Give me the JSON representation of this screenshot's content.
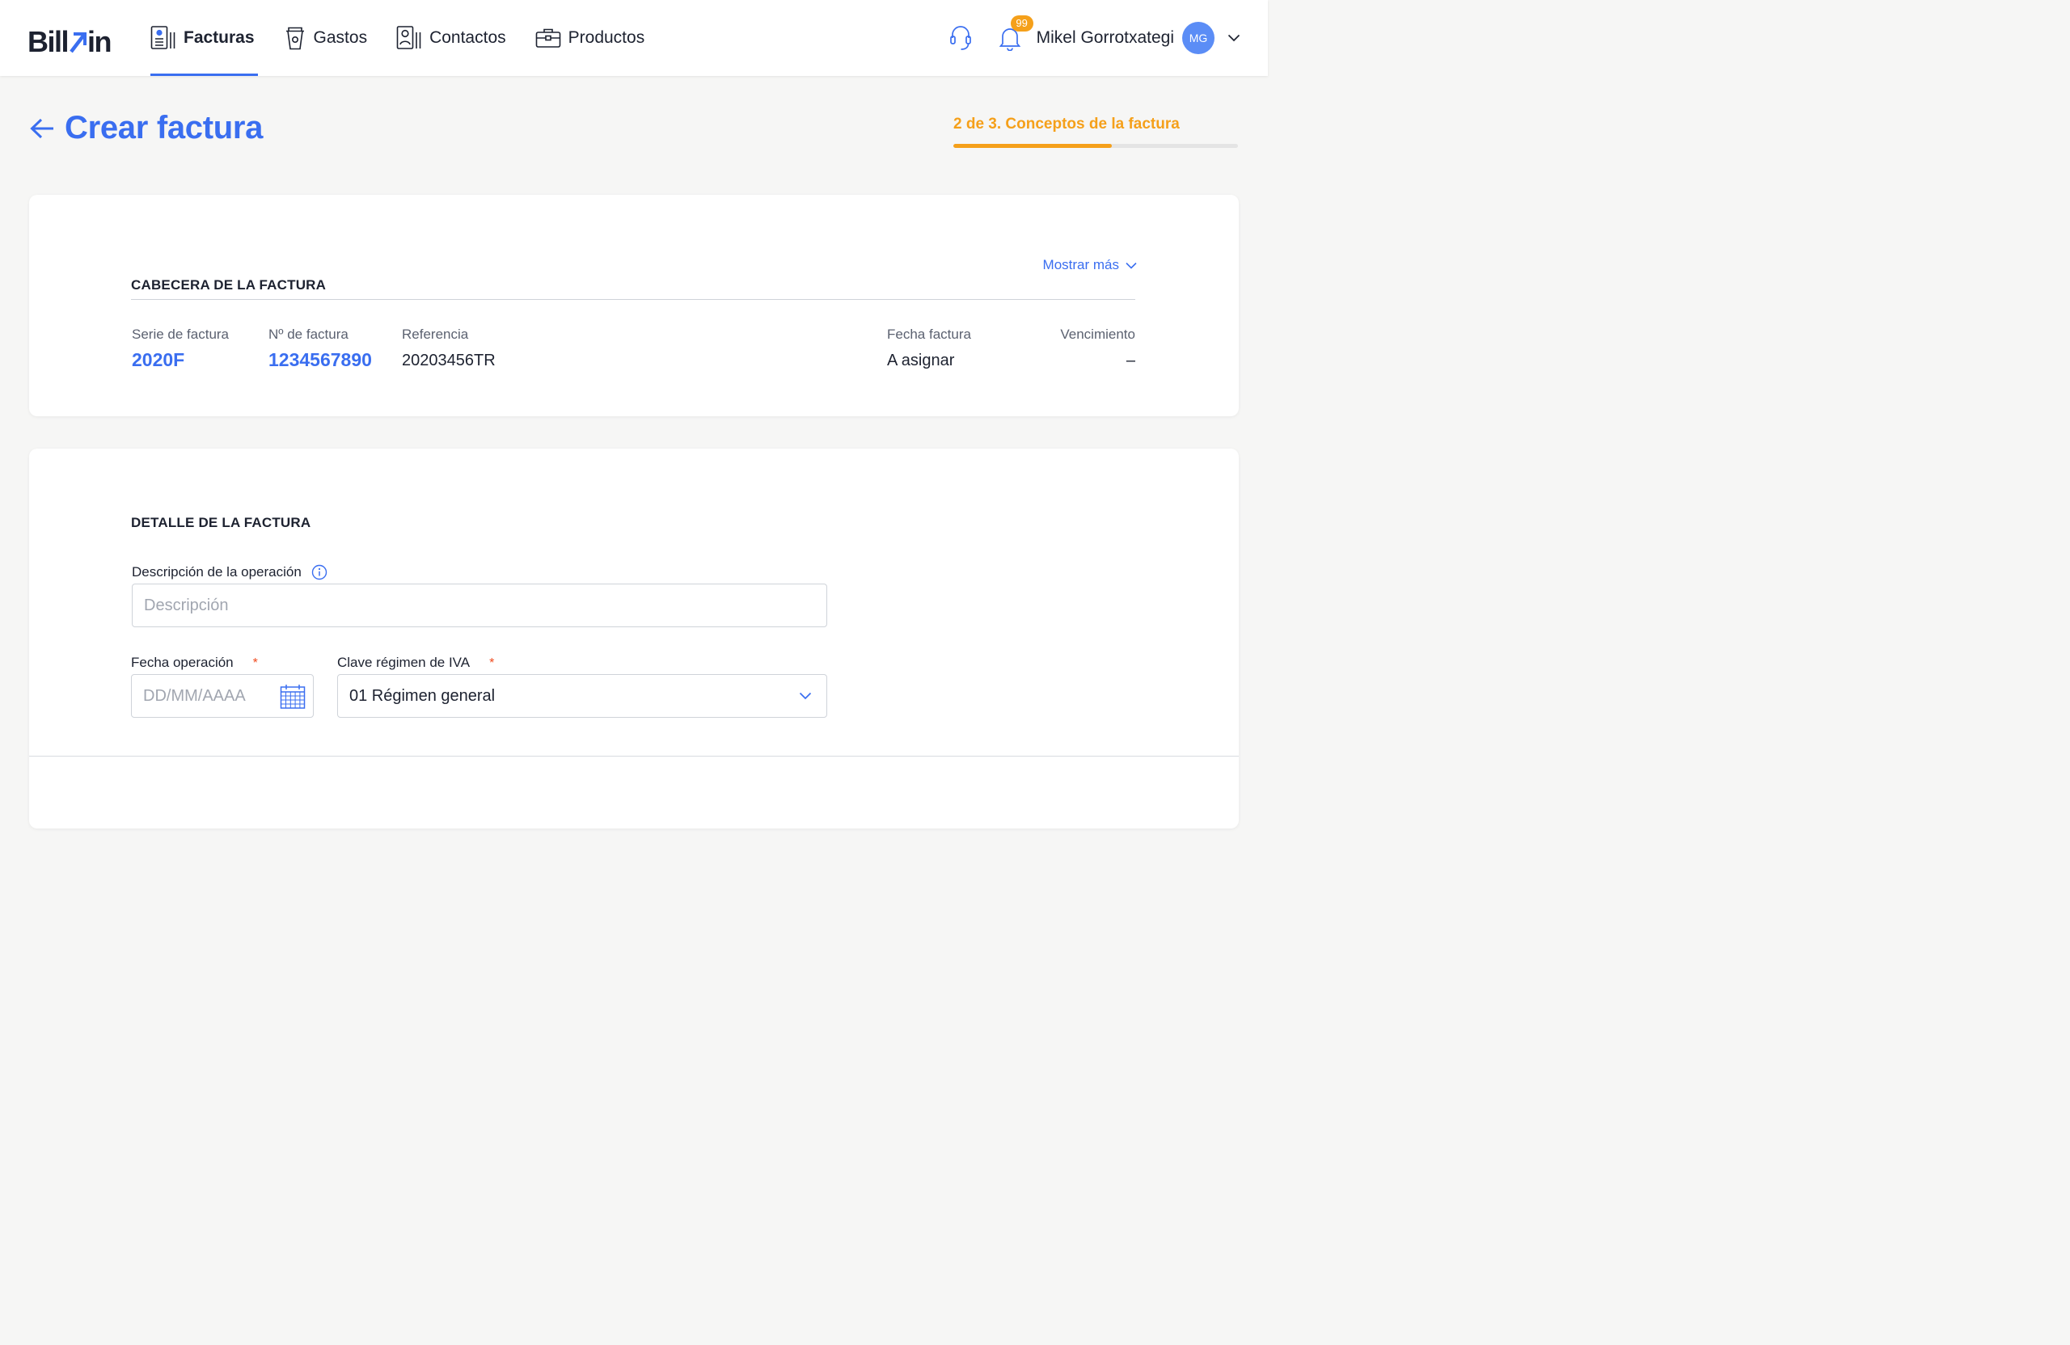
{
  "brand": {
    "logo_left": "Bill",
    "logo_right": "in"
  },
  "nav": {
    "items": [
      {
        "label": "Facturas",
        "icon": "invoice-icon",
        "active": true
      },
      {
        "label": "Gastos",
        "icon": "cup-icon",
        "active": false
      },
      {
        "label": "Contactos",
        "icon": "contacts-icon",
        "active": false
      },
      {
        "label": "Productos",
        "icon": "briefcase-icon",
        "active": false
      }
    ]
  },
  "header_actions": {
    "notification_count": "99",
    "user_name": "Mikel Gorrotxategi",
    "avatar_initials": "MG"
  },
  "page": {
    "title": "Crear factura",
    "step_label": "2 de 3. Conceptos de la factura",
    "step_progress": 0.5556
  },
  "invoice_header": {
    "section_title": "CABECERA DE LA FACTURA",
    "show_more": "Mostrar más",
    "fields": [
      {
        "label": "Serie de factura",
        "value": "2020F"
      },
      {
        "label": "Nº de factura",
        "value": "1234567890"
      },
      {
        "label": "Referencia",
        "value": "20203456TR"
      },
      {
        "label": "Fecha factura",
        "value": "A asignar"
      },
      {
        "label": "Vencimiento",
        "value": "–"
      }
    ]
  },
  "invoice_detail": {
    "section_title": "DETALLE DE LA FACTURA",
    "description_label": "Descripción de la operación",
    "description_placeholder": "Descripción",
    "operation_date_label": "Fecha operación",
    "operation_date_placeholder": "DD/MM/AAAA",
    "vat_regime_label": "Clave régimen de IVA",
    "vat_regime_value": "01 Régimen general",
    "required_marker": "*"
  },
  "colors": {
    "accent": "#3a6ef0",
    "step": "#f5a01a",
    "required": "#f04a1e"
  }
}
